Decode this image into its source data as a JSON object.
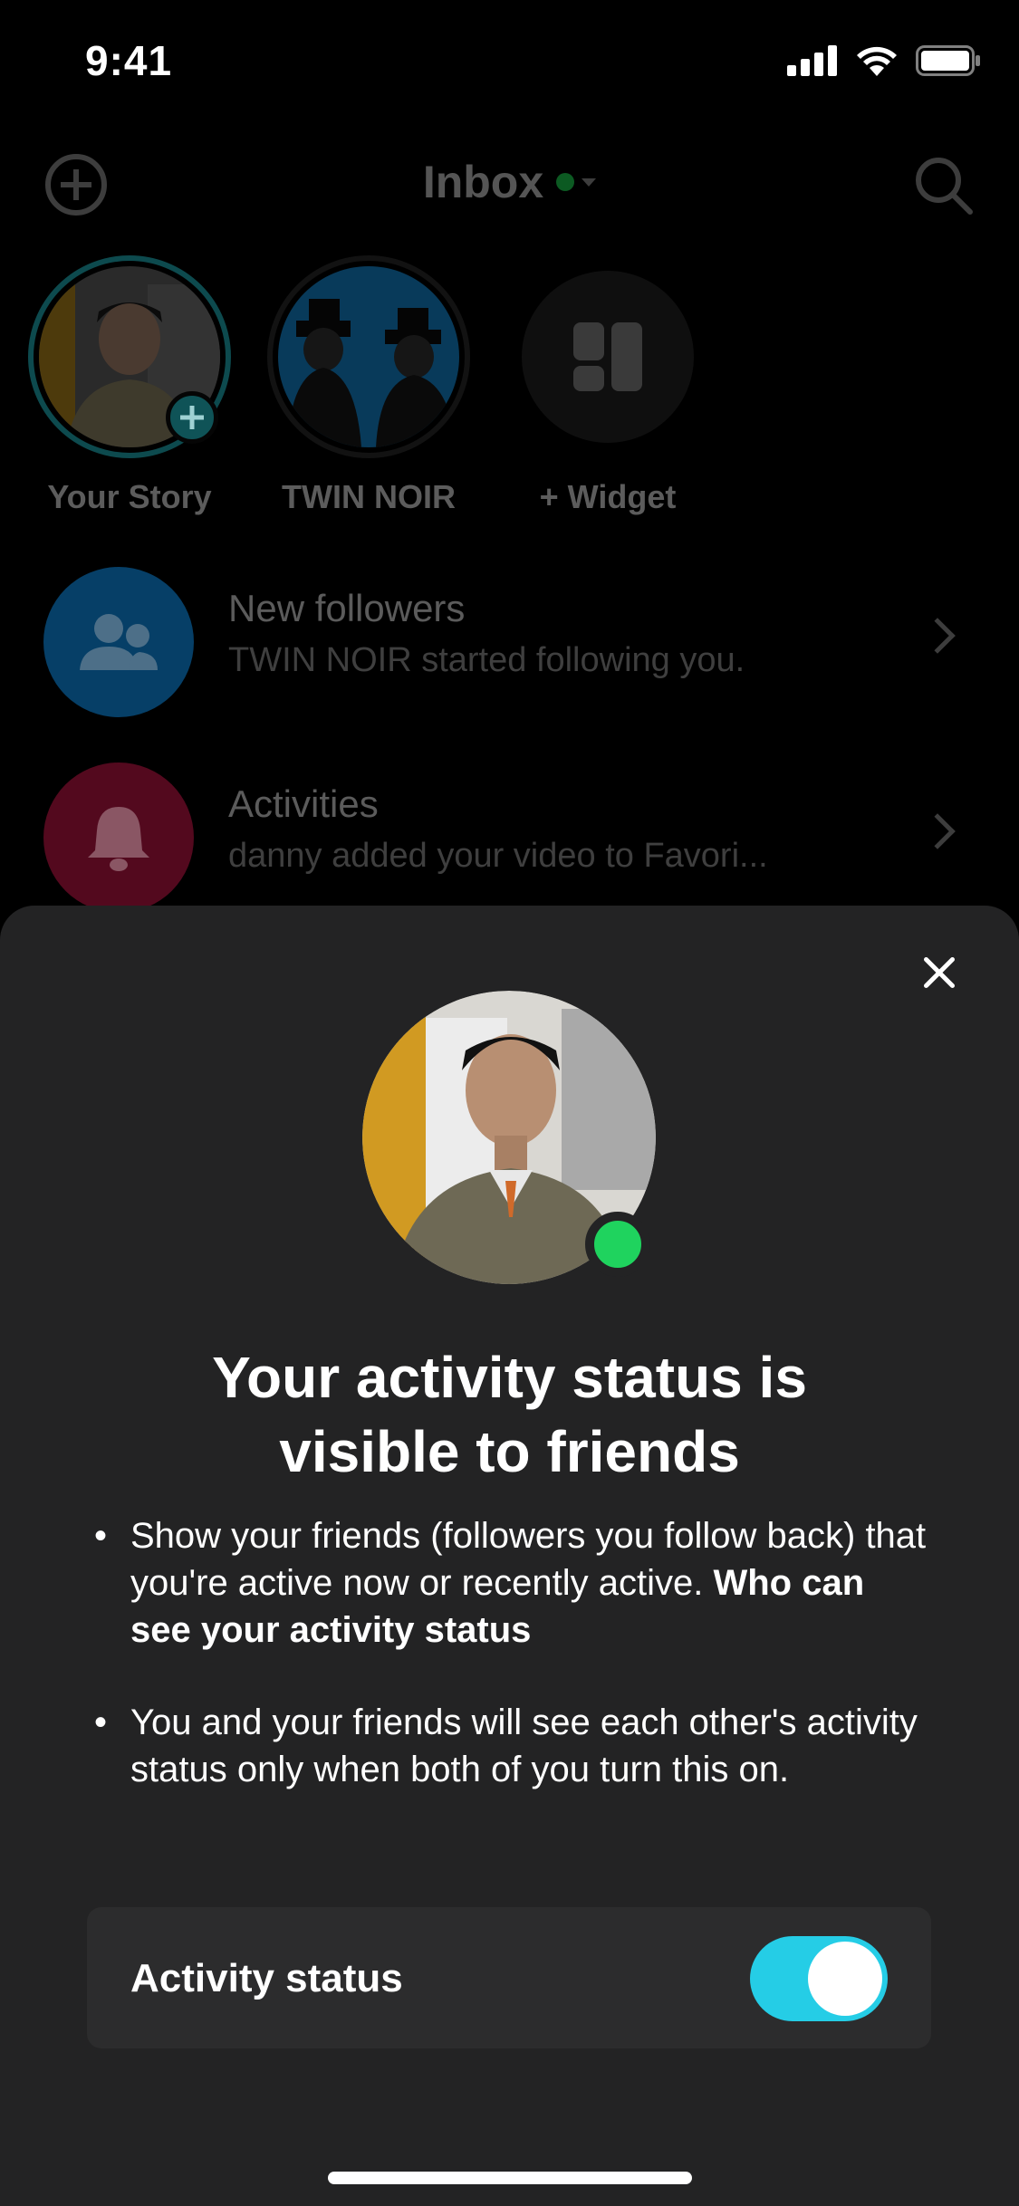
{
  "status_bar": {
    "time": "9:41"
  },
  "inbox": {
    "title": "Inbox",
    "stories": [
      {
        "label": "Your Story"
      },
      {
        "label": "TWIN NOIR"
      },
      {
        "label": "+ Widget"
      }
    ],
    "notifications": [
      {
        "title": "New followers",
        "subtitle": "TWIN NOIR started following you."
      },
      {
        "title": "Activities",
        "subtitle": "danny added your video to Favori..."
      }
    ]
  },
  "sheet": {
    "title_line1": "Your activity status is",
    "title_line2": "visible to friends",
    "bullet1_text": "Show your friends (followers you follow back) that you're active now or recently active. ",
    "bullet1_link": "Who can see your activity status",
    "bullet2_text": "You and your friends will see each other's activity status only when both of you turn this on.",
    "setting_label": "Activity status",
    "setting_on": true
  },
  "colors": {
    "accent": "#25cde6",
    "online": "#1fd35e",
    "sheet_bg": "#232324"
  }
}
